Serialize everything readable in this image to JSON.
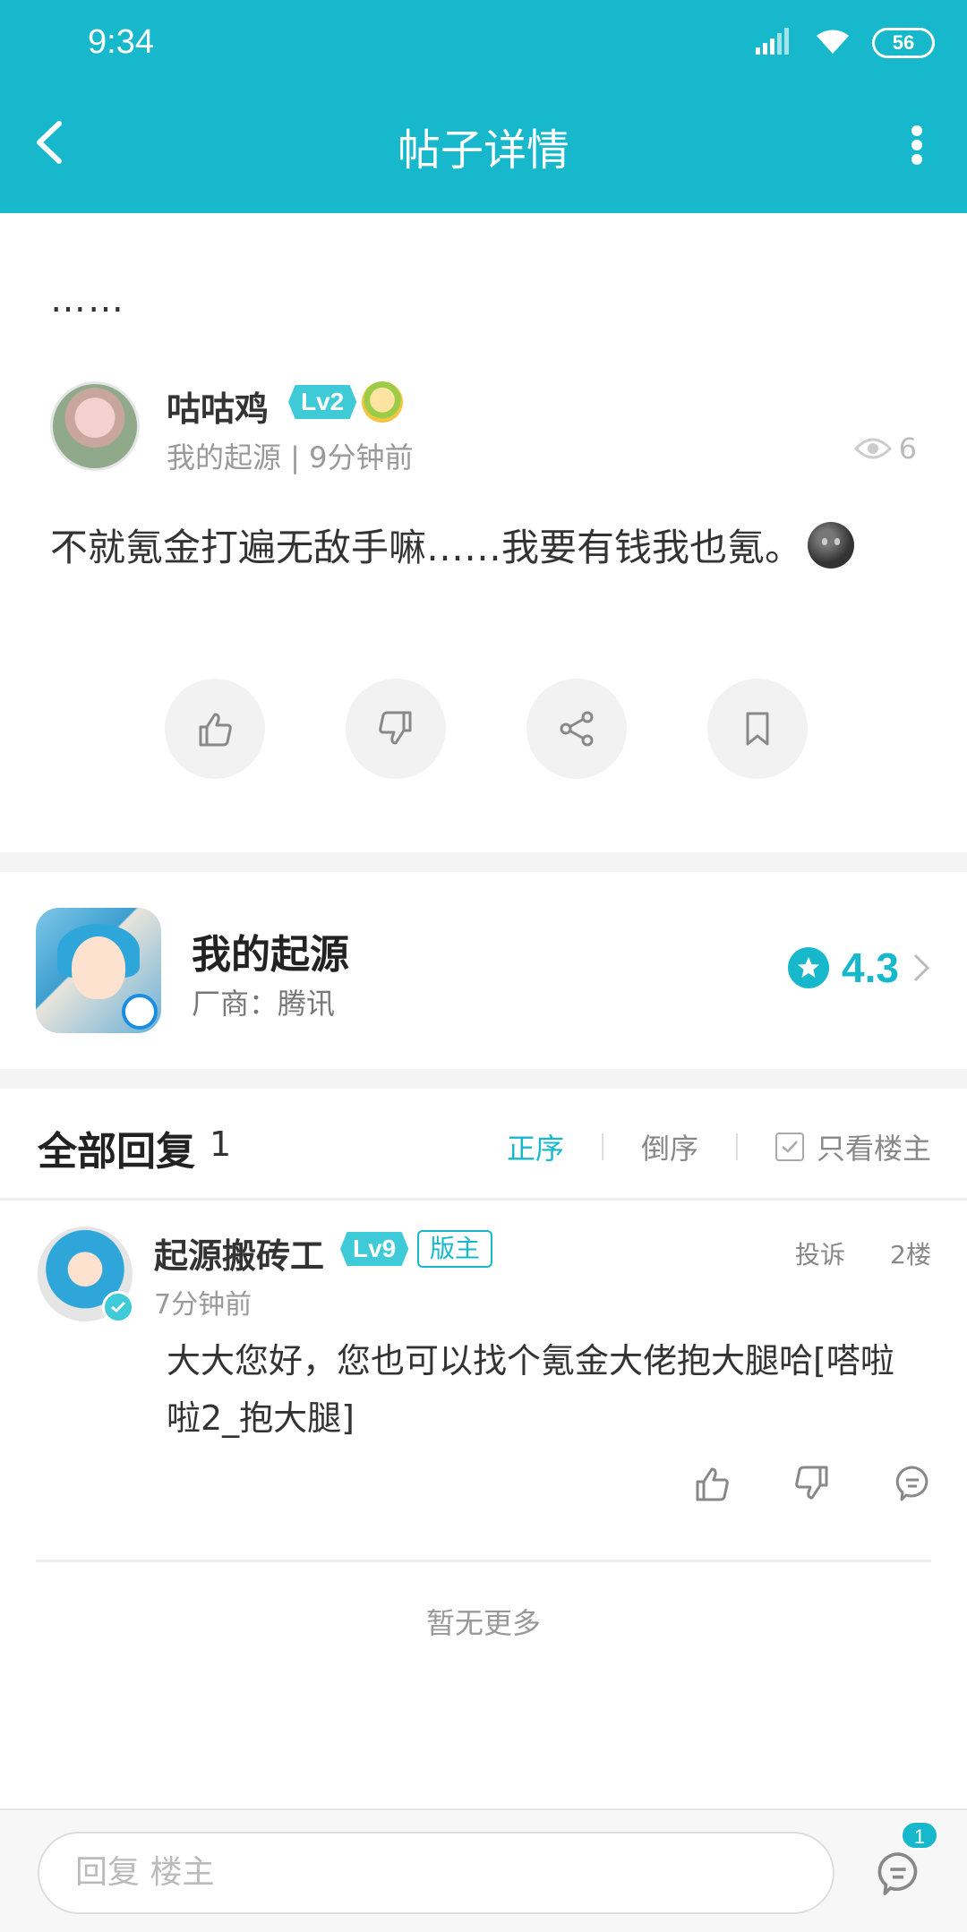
{
  "status_bar": {
    "time": "9:34",
    "battery": "56"
  },
  "header": {
    "title": "帖子详情"
  },
  "post": {
    "title": "……",
    "author": {
      "name": "咕咕鸡",
      "level": "Lv2"
    },
    "meta": "我的起源 | 9分钟前",
    "views": "6",
    "body": "不就氪金打遍无敌手嘛……我要有钱我也氪。"
  },
  "game": {
    "name": "我的起源",
    "vendor": "厂商：腾讯",
    "rating": "4.3"
  },
  "replies": {
    "title": "全部回复",
    "count": "1",
    "sort_asc": "正序",
    "sort_desc": "倒序",
    "owner_only": "只看楼主",
    "items": [
      {
        "name": "起源搬砖工",
        "level": "Lv9",
        "badge": "版主",
        "report": "投诉",
        "floor": "2楼",
        "time": "7分钟前",
        "body": "大大您好，您也可以找个氪金大佬抱大腿哈[嗒啦啦2_抱大腿]"
      }
    ],
    "no_more": "暂无更多"
  },
  "bottom_bar": {
    "placeholder": "回复  楼主",
    "notification_count": "1"
  },
  "colors": {
    "accent": "#17b8cb",
    "background": "#ffffff",
    "separator": "#f3f3f3"
  }
}
